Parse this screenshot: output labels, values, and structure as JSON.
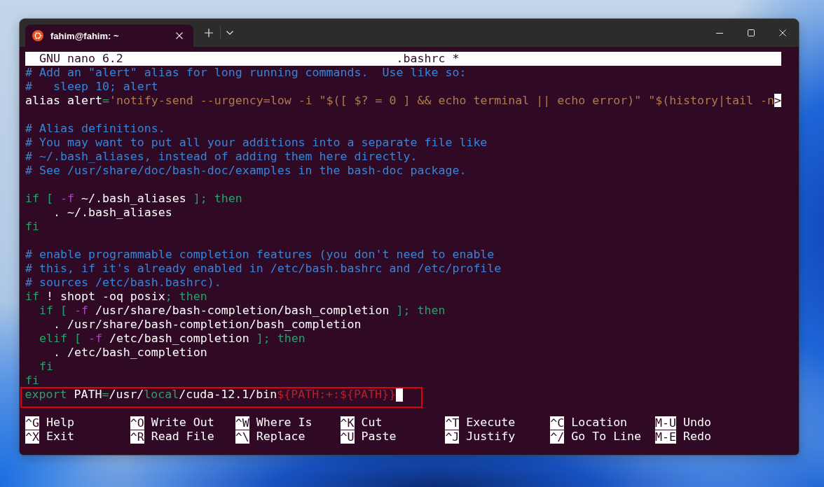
{
  "window": {
    "tab": {
      "title": "fahim@fahim: ~",
      "selected": true
    }
  },
  "nano": {
    "header": {
      "version": "GNU nano 6.2",
      "filename": ".bashrc *"
    },
    "lines": [
      {
        "kind": "code",
        "highlighted": false,
        "segments": [
          {
            "kind": "comment",
            "text": "# Add an \"alert\" alias for long running commands.  Use like so:"
          }
        ]
      },
      {
        "kind": "code",
        "highlighted": false,
        "segments": [
          {
            "kind": "comment",
            "text": "#   sleep 10; alert"
          }
        ]
      },
      {
        "kind": "code",
        "highlighted": false,
        "segments": [
          {
            "kind": "plain",
            "text": "alias alert"
          },
          {
            "kind": "keyword",
            "text": "="
          },
          {
            "kind": "string",
            "text": "'notify-send --urgency=low -i \"$([ $? = 0 ] && echo terminal || echo error)\" \"$(history|tail -n"
          },
          {
            "kind": "overflow",
            "text": ">"
          }
        ]
      },
      {
        "kind": "blank",
        "highlighted": false
      },
      {
        "kind": "code",
        "highlighted": false,
        "segments": [
          {
            "kind": "comment",
            "text": "# Alias definitions."
          }
        ]
      },
      {
        "kind": "code",
        "highlighted": false,
        "segments": [
          {
            "kind": "comment",
            "text": "# You may want to put all your additions into a separate file like"
          }
        ]
      },
      {
        "kind": "code",
        "highlighted": false,
        "segments": [
          {
            "kind": "comment",
            "text": "# ~/.bash_aliases, instead of adding them here directly."
          }
        ]
      },
      {
        "kind": "code",
        "highlighted": false,
        "segments": [
          {
            "kind": "comment",
            "text": "# See /usr/share/doc/bash-doc/examples in the bash-doc package."
          }
        ]
      },
      {
        "kind": "blank",
        "highlighted": false
      },
      {
        "kind": "code",
        "highlighted": false,
        "segments": [
          {
            "kind": "keyword",
            "text": "if [ "
          },
          {
            "kind": "option",
            "text": "-f"
          },
          {
            "kind": "plain",
            "text": " ~/.bash_aliases "
          },
          {
            "kind": "keyword",
            "text": "]; then"
          }
        ]
      },
      {
        "kind": "code",
        "highlighted": false,
        "segments": [
          {
            "kind": "plain",
            "text": "    . ~/.bash_aliases"
          }
        ]
      },
      {
        "kind": "code",
        "highlighted": false,
        "segments": [
          {
            "kind": "keyword",
            "text": "fi"
          }
        ]
      },
      {
        "kind": "blank",
        "highlighted": false
      },
      {
        "kind": "code",
        "highlighted": false,
        "segments": [
          {
            "kind": "comment",
            "text": "# enable programmable completion features (you don't need to enable"
          }
        ]
      },
      {
        "kind": "code",
        "highlighted": false,
        "segments": [
          {
            "kind": "comment",
            "text": "# this, if it's already enabled in /etc/bash.bashrc and /etc/profile"
          }
        ]
      },
      {
        "kind": "code",
        "highlighted": false,
        "segments": [
          {
            "kind": "comment",
            "text": "# sources /etc/bash.bashrc)."
          }
        ]
      },
      {
        "kind": "code",
        "highlighted": false,
        "segments": [
          {
            "kind": "keyword",
            "text": "if"
          },
          {
            "kind": "plain",
            "text": " ! shopt -oq posix"
          },
          {
            "kind": "keyword",
            "text": "; then"
          }
        ]
      },
      {
        "kind": "code",
        "highlighted": false,
        "segments": [
          {
            "kind": "keyword",
            "text": "  if [ "
          },
          {
            "kind": "option",
            "text": "-f"
          },
          {
            "kind": "plain",
            "text": " /usr/share/bash-completion/bash_completion "
          },
          {
            "kind": "keyword",
            "text": "]; then"
          }
        ]
      },
      {
        "kind": "code",
        "highlighted": false,
        "segments": [
          {
            "kind": "plain",
            "text": "    . /usr/share/bash-completion/bash_completion"
          }
        ]
      },
      {
        "kind": "code",
        "highlighted": false,
        "segments": [
          {
            "kind": "keyword",
            "text": "  elif [ "
          },
          {
            "kind": "option",
            "text": "-f"
          },
          {
            "kind": "plain",
            "text": " /etc/bash_completion "
          },
          {
            "kind": "keyword",
            "text": "]; then"
          }
        ]
      },
      {
        "kind": "code",
        "highlighted": false,
        "segments": [
          {
            "kind": "plain",
            "text": "    . /etc/bash_completion"
          }
        ]
      },
      {
        "kind": "code",
        "highlighted": false,
        "segments": [
          {
            "kind": "keyword",
            "text": "  fi"
          }
        ]
      },
      {
        "kind": "code",
        "highlighted": false,
        "segments": [
          {
            "kind": "keyword",
            "text": "fi"
          }
        ]
      },
      {
        "kind": "code",
        "highlighted": true,
        "segments": [
          {
            "kind": "keyword",
            "text": "export"
          },
          {
            "kind": "plain",
            "text": " PATH"
          },
          {
            "kind": "keyword",
            "text": "="
          },
          {
            "kind": "plain",
            "text": "/usr/"
          },
          {
            "kind": "keyword",
            "text": "local"
          },
          {
            "kind": "plain",
            "text": "/cuda-12.1/bin"
          },
          {
            "kind": "variable",
            "text": "${PATH:+:${PATH}}"
          },
          {
            "kind": "cursor"
          }
        ]
      }
    ],
    "shortcut_rows": [
      [
        {
          "key": "^G",
          "label": "Help"
        },
        {
          "key": "^O",
          "label": "Write Out"
        },
        {
          "key": "^W",
          "label": "Where Is"
        },
        {
          "key": "^K",
          "label": "Cut"
        },
        {
          "key": "^T",
          "label": "Execute"
        },
        {
          "key": "^C",
          "label": "Location"
        },
        {
          "key": "M-U",
          "label": "Undo"
        }
      ],
      [
        {
          "key": "^X",
          "label": "Exit"
        },
        {
          "key": "^R",
          "label": "Read File"
        },
        {
          "key": "^\\",
          "label": "Replace"
        },
        {
          "key": "^U",
          "label": "Paste"
        },
        {
          "key": "^J",
          "label": "Justify"
        },
        {
          "key": "^/",
          "label": "Go To Line"
        },
        {
          "key": "M-E",
          "label": "Redo"
        }
      ]
    ]
  }
}
